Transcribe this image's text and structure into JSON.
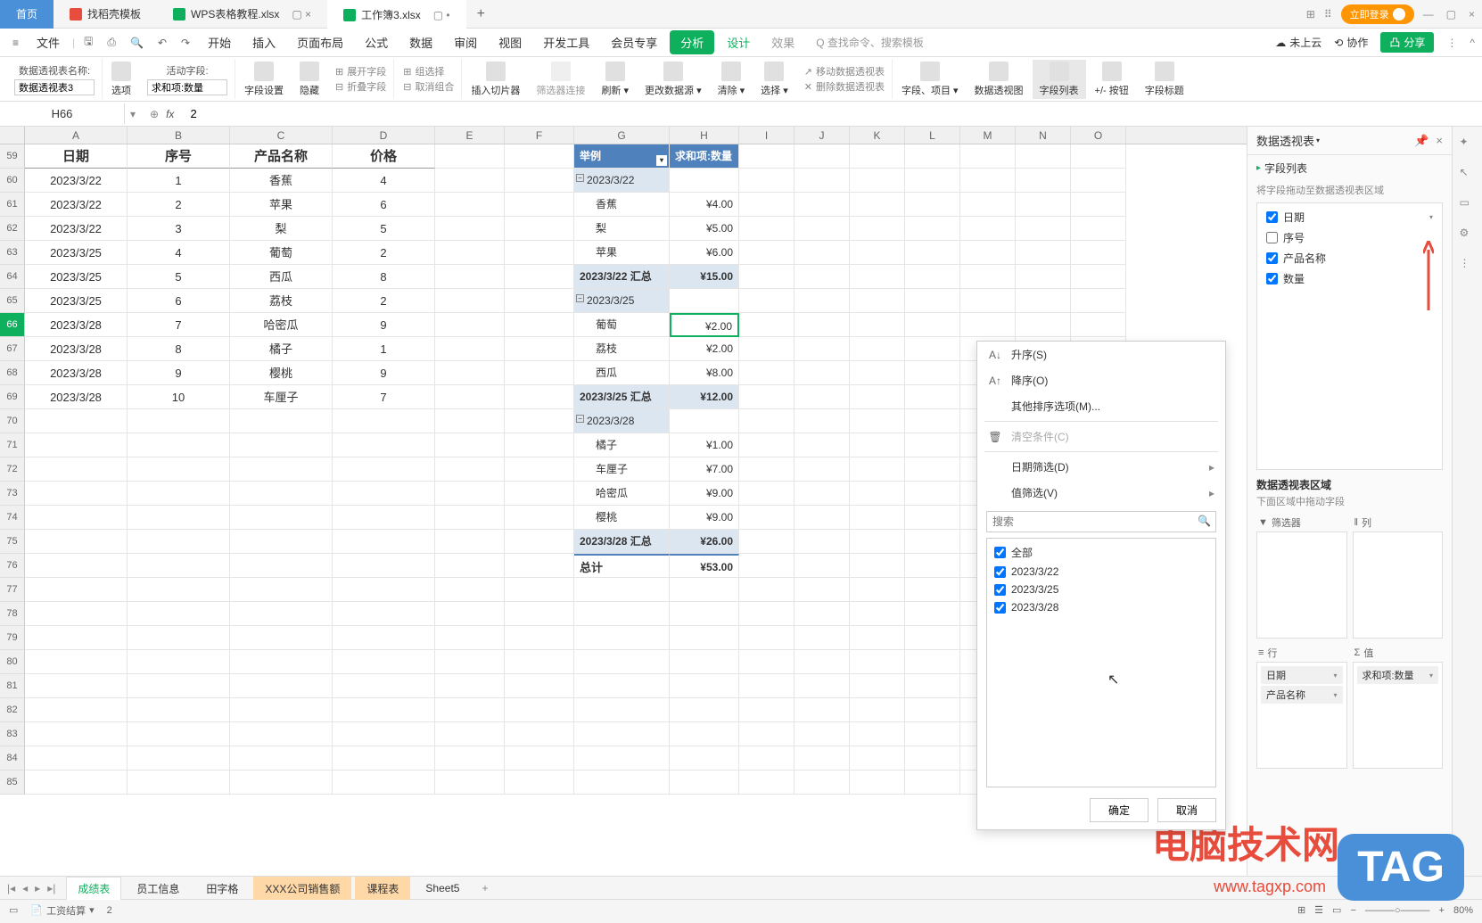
{
  "tabs": {
    "home": "首页",
    "template": "找稻壳模板",
    "file1": "WPS表格教程.xlsx",
    "file2": "工作簿3.xlsx"
  },
  "topRight": {
    "login": "立即登录"
  },
  "menu": {
    "file": "文件",
    "items": [
      "开始",
      "插入",
      "页面布局",
      "公式",
      "数据",
      "审阅",
      "视图",
      "开发工具",
      "会员专享"
    ],
    "analysis": "分析",
    "design": "设计",
    "effect": "效果",
    "aiSearch": "Q 查找命令、搜索模板",
    "cloud": "未上云",
    "collab": "协作",
    "share": "分享"
  },
  "ribbon": {
    "pivotNameLabel": "数据透视表名称:",
    "pivotName": "数据透视表3",
    "options": "选项",
    "activeFieldLabel": "活动字段:",
    "activeField": "求和项:数量",
    "fieldSettings": "字段设置",
    "hide": "隐藏",
    "expandField": "展开字段",
    "collapseField": "折叠字段",
    "groupSelect": "组选择",
    "ungroup": "取消组合",
    "insertSlicer": "插入切片器",
    "filterConnect": "筛选器连接",
    "refresh": "刷新",
    "changeDataSource": "更改数据源",
    "clear": "清除",
    "select": "选择",
    "movePivot": "移动数据透视表",
    "deletePivot": "删除数据透视表",
    "fieldsItems": "字段、项目",
    "pivotChart": "数据透视图",
    "fieldList": "字段列表",
    "plusMinusBtn": "+/- 按钮",
    "fieldHeaders": "字段标题"
  },
  "formula": {
    "nameBox": "H66",
    "fx": "fx",
    "value": "2"
  },
  "cols": [
    "A",
    "B",
    "C",
    "D",
    "E",
    "F",
    "G",
    "H",
    "I",
    "J",
    "K",
    "L",
    "M",
    "N",
    "O"
  ],
  "headers": {
    "date": "日期",
    "seq": "序号",
    "product": "产品名称",
    "price": "价格"
  },
  "rows": [
    {
      "n": "59",
      "date": "日期",
      "seq": "序号",
      "product": "产品名称",
      "price": "价格",
      "hdr": true
    },
    {
      "n": "60",
      "date": "2023/3/22",
      "seq": "1",
      "product": "香蕉",
      "price": "4"
    },
    {
      "n": "61",
      "date": "2023/3/22",
      "seq": "2",
      "product": "苹果",
      "price": "6"
    },
    {
      "n": "62",
      "date": "2023/3/22",
      "seq": "3",
      "product": "梨",
      "price": "5"
    },
    {
      "n": "63",
      "date": "2023/3/25",
      "seq": "4",
      "product": "葡萄",
      "price": "2"
    },
    {
      "n": "64",
      "date": "2023/3/25",
      "seq": "5",
      "product": "西瓜",
      "price": "8"
    },
    {
      "n": "65",
      "date": "2023/3/25",
      "seq": "6",
      "product": "荔枝",
      "price": "2"
    },
    {
      "n": "66",
      "date": "2023/3/28",
      "seq": "7",
      "product": "哈密瓜",
      "price": "9",
      "active": true
    },
    {
      "n": "67",
      "date": "2023/3/28",
      "seq": "8",
      "product": "橘子",
      "price": "1"
    },
    {
      "n": "68",
      "date": "2023/3/28",
      "seq": "9",
      "product": "樱桃",
      "price": "9"
    },
    {
      "n": "69",
      "date": "2023/3/28",
      "seq": "10",
      "product": "车厘子",
      "price": "7"
    }
  ],
  "extraRows": [
    "70",
    "71",
    "72",
    "73",
    "74",
    "75",
    "76",
    "77",
    "78",
    "79",
    "80",
    "81",
    "82",
    "83",
    "84",
    "85"
  ],
  "pivot": {
    "exampleHdr": "举例",
    "sumHdr": "求和项:数量",
    "groups": [
      {
        "date": "2023/3/22",
        "items": [
          {
            "name": "香蕉",
            "val": "¥4.00"
          },
          {
            "name": "梨",
            "val": "¥5.00"
          },
          {
            "name": "苹果",
            "val": "¥6.00"
          }
        ],
        "subtotal": "2023/3/22 汇总",
        "subval": "¥15.00"
      },
      {
        "date": "2023/3/25",
        "items": [
          {
            "name": "葡萄",
            "val": "¥2.00",
            "selected": true
          },
          {
            "name": "荔枝",
            "val": "¥2.00"
          },
          {
            "name": "西瓜",
            "val": "¥8.00"
          }
        ],
        "subtotal": "2023/3/25 汇总",
        "subval": "¥12.00"
      },
      {
        "date": "2023/3/28",
        "items": [
          {
            "name": "橘子",
            "val": "¥1.00"
          },
          {
            "name": "车厘子",
            "val": "¥7.00"
          },
          {
            "name": "哈密瓜",
            "val": "¥9.00"
          },
          {
            "name": "樱桃",
            "val": "¥9.00"
          }
        ],
        "subtotal": "2023/3/28 汇总",
        "subval": "¥26.00"
      }
    ],
    "totalLabel": "总计",
    "totalVal": "¥53.00"
  },
  "popup": {
    "sortAsc": "升序(S)",
    "sortDesc": "降序(O)",
    "moreSort": "其他排序选项(M)...",
    "clearCond": "清空条件(C)",
    "dateFilter": "日期筛选(D)",
    "valueFilter": "值筛选(V)",
    "searchPlaceholder": "搜索",
    "all": "全部",
    "items": [
      "2023/3/22",
      "2023/3/25",
      "2023/3/28"
    ],
    "ok": "确定",
    "cancel": "取消"
  },
  "rightPanel": {
    "title": "数据透视表",
    "fieldListTitle": "字段列表",
    "fieldHint": "将字段拖动至数据透视表区域",
    "fields": [
      {
        "name": "日期",
        "checked": true,
        "dd": true
      },
      {
        "name": "序号",
        "checked": false
      },
      {
        "name": "产品名称",
        "checked": true
      },
      {
        "name": "数量",
        "checked": true
      }
    ],
    "areasTitle": "数据透视表区域",
    "areasHint": "下面区域中拖动字段",
    "filterLabel": "筛选器",
    "colLabel": "列",
    "rowLabel": "行",
    "valLabel": "值",
    "rowItems": [
      "日期",
      "产品名称"
    ],
    "valItems": [
      "求和项:数量"
    ]
  },
  "sheets": {
    "tabs": [
      "成绩表",
      "员工信息",
      "田字格",
      "XXX公司销售额",
      "课程表",
      "Sheet5"
    ]
  },
  "status": {
    "salary": "工资结算",
    "count": "2",
    "zoom": "80%"
  },
  "watermark": {
    "text": "电脑技术网",
    "url": "www.tagxp.com",
    "tag": "TAG"
  }
}
